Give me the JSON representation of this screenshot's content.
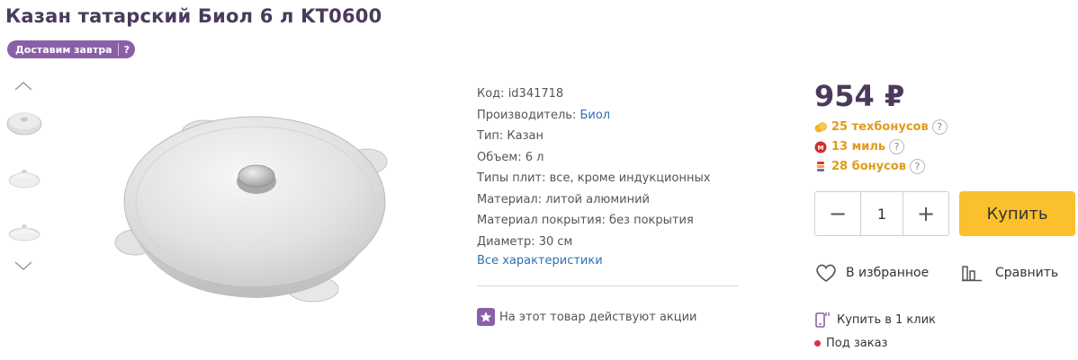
{
  "product": {
    "title": "Казан татарский Биол 6 л KT0600",
    "delivery_badge": "Доставим завтра",
    "delivery_help": "?"
  },
  "specs": [
    {
      "label": "Код: ",
      "value": "id341718",
      "link": false
    },
    {
      "label": "Производитель: ",
      "value": "Биол",
      "link": true
    },
    {
      "label": "Тип: ",
      "value": "Казан",
      "link": false
    },
    {
      "label": "Объем: ",
      "value": "6 л",
      "link": false
    },
    {
      "label": "Типы плит: ",
      "value": "все, кроме индукционных",
      "link": false
    },
    {
      "label": "Материал: ",
      "value": "литой алюминий",
      "link": false
    },
    {
      "label": "Материал покрытия: ",
      "value": "без покрытия",
      "link": false
    },
    {
      "label": "Диаметр: ",
      "value": "30 см",
      "link": false
    }
  ],
  "all_characteristics": "Все характеристики",
  "promo_text": "На этот товар действуют акции",
  "price": "954 ₽",
  "bonuses": [
    {
      "text": "25 техбонусов",
      "color": "#e09b1a",
      "icon": "coin-icon",
      "help": "?"
    },
    {
      "text": "13 миль",
      "color": "#e09b1a",
      "icon": "miles-icon",
      "help": "?"
    },
    {
      "text": "28 бонусов",
      "color": "#e09b1a",
      "icon": "bonus-stack-icon",
      "help": "?"
    }
  ],
  "quantity": {
    "value": "1",
    "minus": "−",
    "plus": "+"
  },
  "buy_label": "Купить",
  "favorite_label": "В избранное",
  "compare_label": "Сравнить",
  "one_click_label": "Купить в 1 клик",
  "availability": "Под заказ",
  "colors": {
    "brand": "#4a3b5c",
    "accent": "#8b5fa8",
    "buy": "#fbc02d",
    "link": "#2f6fb3",
    "bonus": "#e09b1a"
  }
}
